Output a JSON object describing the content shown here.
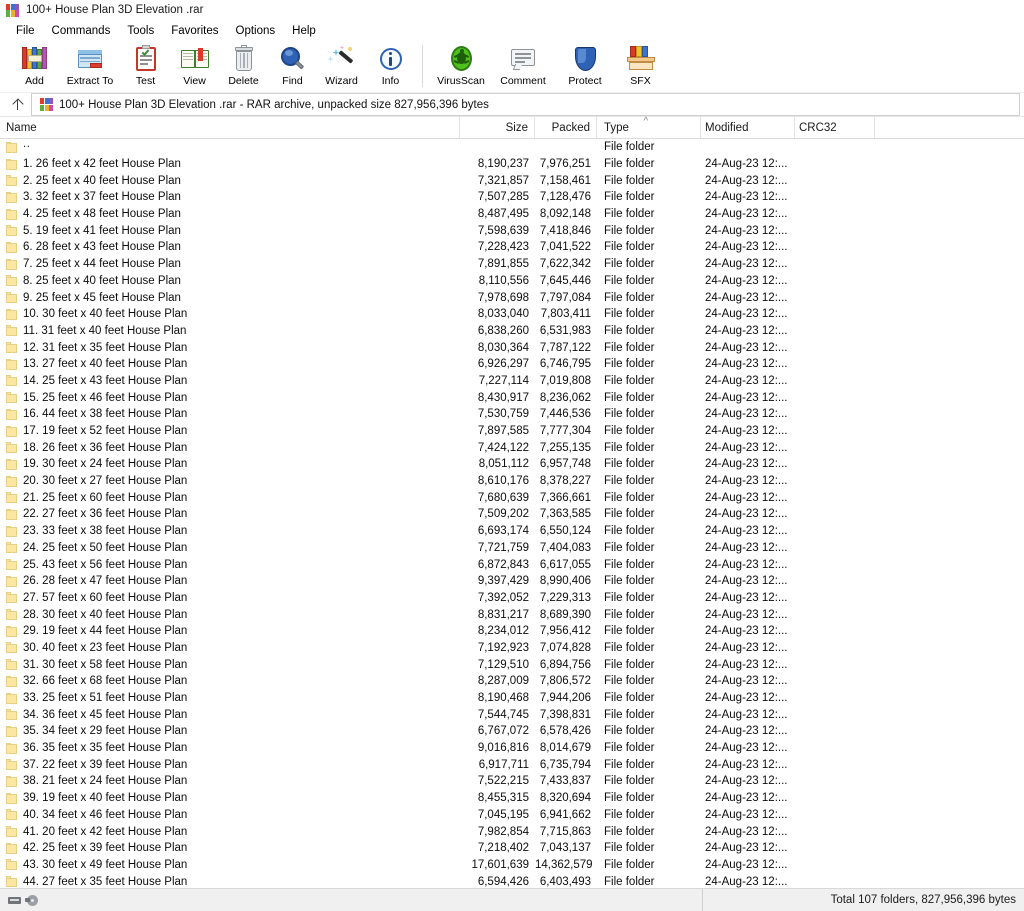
{
  "window": {
    "title": "100+ House Plan 3D Elevation .rar",
    "icon": "winrar-icon"
  },
  "menu": {
    "items": [
      {
        "label": "File"
      },
      {
        "label": "Commands"
      },
      {
        "label": "Tools"
      },
      {
        "label": "Favorites"
      },
      {
        "label": "Options"
      },
      {
        "label": "Help"
      }
    ]
  },
  "toolbar": {
    "buttons": [
      {
        "label": "Add",
        "icon": "add-archive-icon"
      },
      {
        "label": "Extract To",
        "icon": "extract-folder-icon"
      },
      {
        "label": "Test",
        "icon": "test-clipboard-icon"
      },
      {
        "label": "View",
        "icon": "view-book-icon"
      },
      {
        "label": "Delete",
        "icon": "delete-trash-icon"
      },
      {
        "label": "Find",
        "icon": "find-magnifier-icon"
      },
      {
        "label": "Wizard",
        "icon": "wizard-wand-icon"
      },
      {
        "label": "Info",
        "icon": "info-circle-icon"
      }
    ],
    "buttons_right": [
      {
        "label": "VirusScan",
        "icon": "virusscan-bug-icon"
      },
      {
        "label": "Comment",
        "icon": "comment-bubble-icon"
      },
      {
        "label": "Protect",
        "icon": "protect-shield-icon"
      },
      {
        "label": "SFX",
        "icon": "sfx-box-icon"
      }
    ]
  },
  "address": {
    "up_icon": "up-arrow-icon",
    "archive_icon": "winrar-icon",
    "text": "100+ House Plan 3D Elevation .rar - RAR archive, unpacked size 827,956,396 bytes"
  },
  "columns": [
    {
      "key": "name",
      "label": "Name",
      "align": "left",
      "sorted": false
    },
    {
      "key": "size",
      "label": "Size",
      "align": "right",
      "sorted": false
    },
    {
      "key": "packed",
      "label": "Packed",
      "align": "right",
      "sorted": false
    },
    {
      "key": "type",
      "label": "Type",
      "align": "left",
      "sorted": true,
      "sort_mark": "^"
    },
    {
      "key": "modified",
      "label": "Modified",
      "align": "left",
      "sorted": false
    },
    {
      "key": "crc",
      "label": "CRC32",
      "align": "left",
      "sorted": false
    }
  ],
  "rows": [
    {
      "name": "..",
      "parent": true,
      "size": "",
      "packed": "",
      "type": "File folder",
      "modified": "",
      "crc": ""
    },
    {
      "name": "1. 26 feet x 42 feet House Plan",
      "size": "8,190,237",
      "packed": "7,976,251",
      "type": "File folder",
      "modified": "24-Aug-23 12:...",
      "crc": ""
    },
    {
      "name": "2. 25 feet x 40 feet House Plan",
      "size": "7,321,857",
      "packed": "7,158,461",
      "type": "File folder",
      "modified": "24-Aug-23 12:...",
      "crc": ""
    },
    {
      "name": "3. 32 feet x 37 feet House Plan",
      "size": "7,507,285",
      "packed": "7,128,476",
      "type": "File folder",
      "modified": "24-Aug-23 12:...",
      "crc": ""
    },
    {
      "name": "4. 25 feet x 48 feet House Plan",
      "size": "8,487,495",
      "packed": "8,092,148",
      "type": "File folder",
      "modified": "24-Aug-23 12:...",
      "crc": ""
    },
    {
      "name": "5. 19 feet x 41 feet House Plan",
      "size": "7,598,639",
      "packed": "7,418,846",
      "type": "File folder",
      "modified": "24-Aug-23 12:...",
      "crc": ""
    },
    {
      "name": "6. 28 feet x 43 feet House Plan",
      "size": "7,228,423",
      "packed": "7,041,522",
      "type": "File folder",
      "modified": "24-Aug-23 12:...",
      "crc": ""
    },
    {
      "name": "7. 25 feet x 44 feet House Plan",
      "size": "7,891,855",
      "packed": "7,622,342",
      "type": "File folder",
      "modified": "24-Aug-23 12:...",
      "crc": ""
    },
    {
      "name": "8. 25 feet x 40 feet House Plan",
      "size": "8,110,556",
      "packed": "7,645,446",
      "type": "File folder",
      "modified": "24-Aug-23 12:...",
      "crc": ""
    },
    {
      "name": "9. 25 feet x 45 feet House Plan",
      "size": "7,978,698",
      "packed": "7,797,084",
      "type": "File folder",
      "modified": "24-Aug-23 12:...",
      "crc": ""
    },
    {
      "name": "10. 30 feet x 40 feet House Plan",
      "size": "8,033,040",
      "packed": "7,803,411",
      "type": "File folder",
      "modified": "24-Aug-23 12:...",
      "crc": ""
    },
    {
      "name": "11. 31 feet x 40 feet House Plan",
      "size": "6,838,260",
      "packed": "6,531,983",
      "type": "File folder",
      "modified": "24-Aug-23 12:...",
      "crc": ""
    },
    {
      "name": "12. 31 feet x 35 feet House Plan",
      "size": "8,030,364",
      "packed": "7,787,122",
      "type": "File folder",
      "modified": "24-Aug-23 12:...",
      "crc": ""
    },
    {
      "name": "13. 27 feet x 40 feet House Plan",
      "size": "6,926,297",
      "packed": "6,746,795",
      "type": "File folder",
      "modified": "24-Aug-23 12:...",
      "crc": ""
    },
    {
      "name": "14. 25 feet x 43 feet House Plan",
      "size": "7,227,114",
      "packed": "7,019,808",
      "type": "File folder",
      "modified": "24-Aug-23 12:...",
      "crc": ""
    },
    {
      "name": "15. 25 feet x 46 feet House Plan",
      "size": "8,430,917",
      "packed": "8,236,062",
      "type": "File folder",
      "modified": "24-Aug-23 12:...",
      "crc": ""
    },
    {
      "name": "16. 44 feet x 38 feet House Plan",
      "size": "7,530,759",
      "packed": "7,446,536",
      "type": "File folder",
      "modified": "24-Aug-23 12:...",
      "crc": ""
    },
    {
      "name": "17. 19 feet x 52 feet House Plan",
      "size": "7,897,585",
      "packed": "7,777,304",
      "type": "File folder",
      "modified": "24-Aug-23 12:...",
      "crc": ""
    },
    {
      "name": "18. 26 feet x 36 feet House Plan",
      "size": "7,424,122",
      "packed": "7,255,135",
      "type": "File folder",
      "modified": "24-Aug-23 12:...",
      "crc": ""
    },
    {
      "name": "19. 30 feet x 24 feet House Plan",
      "size": "8,051,112",
      "packed": "6,957,748",
      "type": "File folder",
      "modified": "24-Aug-23 12:...",
      "crc": ""
    },
    {
      "name": "20. 30 feet x 27 feet House Plan",
      "size": "8,610,176",
      "packed": "8,378,227",
      "type": "File folder",
      "modified": "24-Aug-23 12:...",
      "crc": ""
    },
    {
      "name": "21. 25 feet x 60 feet House Plan",
      "size": "7,680,639",
      "packed": "7,366,661",
      "type": "File folder",
      "modified": "24-Aug-23 12:...",
      "crc": ""
    },
    {
      "name": "22. 27 feet x 36 feet House Plan",
      "size": "7,509,202",
      "packed": "7,363,585",
      "type": "File folder",
      "modified": "24-Aug-23 12:...",
      "crc": ""
    },
    {
      "name": "23. 33 feet x 38 feet House Plan",
      "size": "6,693,174",
      "packed": "6,550,124",
      "type": "File folder",
      "modified": "24-Aug-23 12:...",
      "crc": ""
    },
    {
      "name": "24. 25 feet x 50 feet House Plan",
      "size": "7,721,759",
      "packed": "7,404,083",
      "type": "File folder",
      "modified": "24-Aug-23 12:...",
      "crc": ""
    },
    {
      "name": "25. 43 feet x 56 feet House Plan",
      "size": "6,872,843",
      "packed": "6,617,055",
      "type": "File folder",
      "modified": "24-Aug-23 12:...",
      "crc": ""
    },
    {
      "name": "26. 28 feet x 47 feet House Plan",
      "size": "9,397,429",
      "packed": "8,990,406",
      "type": "File folder",
      "modified": "24-Aug-23 12:...",
      "crc": ""
    },
    {
      "name": "27. 57 feet x 60 feet House Plan",
      "size": "7,392,052",
      "packed": "7,229,313",
      "type": "File folder",
      "modified": "24-Aug-23 12:...",
      "crc": ""
    },
    {
      "name": "28. 30 feet x 40 feet House Plan",
      "size": "8,831,217",
      "packed": "8,689,390",
      "type": "File folder",
      "modified": "24-Aug-23 12:...",
      "crc": ""
    },
    {
      "name": "29. 19 feet x 44 feet House Plan",
      "size": "8,234,012",
      "packed": "7,956,412",
      "type": "File folder",
      "modified": "24-Aug-23 12:...",
      "crc": ""
    },
    {
      "name": "30. 40 feet x 23 feet House Plan",
      "size": "7,192,923",
      "packed": "7,074,828",
      "type": "File folder",
      "modified": "24-Aug-23 12:...",
      "crc": ""
    },
    {
      "name": "31. 30 feet x 58 feet House Plan",
      "size": "7,129,510",
      "packed": "6,894,756",
      "type": "File folder",
      "modified": "24-Aug-23 12:...",
      "crc": ""
    },
    {
      "name": "32. 66 feet x 68 feet House Plan",
      "size": "8,287,009",
      "packed": "7,806,572",
      "type": "File folder",
      "modified": "24-Aug-23 12:...",
      "crc": ""
    },
    {
      "name": "33. 25 feet x 51 feet House Plan",
      "size": "8,190,468",
      "packed": "7,944,206",
      "type": "File folder",
      "modified": "24-Aug-23 12:...",
      "crc": ""
    },
    {
      "name": "34. 36 feet x 45 feet House Plan",
      "size": "7,544,745",
      "packed": "7,398,831",
      "type": "File folder",
      "modified": "24-Aug-23 12:...",
      "crc": ""
    },
    {
      "name": "35. 34 feet x 29 feet House Plan",
      "size": "6,767,072",
      "packed": "6,578,426",
      "type": "File folder",
      "modified": "24-Aug-23 12:...",
      "crc": ""
    },
    {
      "name": "36. 35 feet x 35 feet House Plan",
      "size": "9,016,816",
      "packed": "8,014,679",
      "type": "File folder",
      "modified": "24-Aug-23 12:...",
      "crc": ""
    },
    {
      "name": "37. 22 feet x 39 feet House Plan",
      "size": "6,917,711",
      "packed": "6,735,794",
      "type": "File folder",
      "modified": "24-Aug-23 12:...",
      "crc": ""
    },
    {
      "name": "38. 21 feet x 24 feet House Plan",
      "size": "7,522,215",
      "packed": "7,433,837",
      "type": "File folder",
      "modified": "24-Aug-23 12:...",
      "crc": ""
    },
    {
      "name": "39. 19 feet x 40 feet House Plan",
      "size": "8,455,315",
      "packed": "8,320,694",
      "type": "File folder",
      "modified": "24-Aug-23 12:...",
      "crc": ""
    },
    {
      "name": "40. 34 feet x 46 feet House Plan",
      "size": "7,045,195",
      "packed": "6,941,662",
      "type": "File folder",
      "modified": "24-Aug-23 12:...",
      "crc": ""
    },
    {
      "name": "41. 20 feet x 42 feet House Plan",
      "size": "7,982,854",
      "packed": "7,715,863",
      "type": "File folder",
      "modified": "24-Aug-23 12:...",
      "crc": ""
    },
    {
      "name": "42. 25 feet x 39 feet House Plan",
      "size": "7,218,402",
      "packed": "7,043,137",
      "type": "File folder",
      "modified": "24-Aug-23 12:...",
      "crc": ""
    },
    {
      "name": "43. 30 feet x 49 feet House Plan",
      "size": "17,601,639",
      "packed": "14,362,579",
      "type": "File folder",
      "modified": "24-Aug-23 12:...",
      "crc": ""
    },
    {
      "name": "44. 27 feet x 35 feet House Plan",
      "size": "6,594,426",
      "packed": "6,403,493",
      "type": "File folder",
      "modified": "24-Aug-23 12:...",
      "crc": ""
    }
  ],
  "statusbar": {
    "left_icons": [
      "drive-icon",
      "disk-icon"
    ],
    "total": "Total 107 folders, 827,956,396 bytes"
  },
  "colors": {
    "folder_fill": "#fbe6a2",
    "folder_edge": "#e8cf86",
    "status_bg": "#f0f0f0",
    "text": "#0d0d0d"
  }
}
